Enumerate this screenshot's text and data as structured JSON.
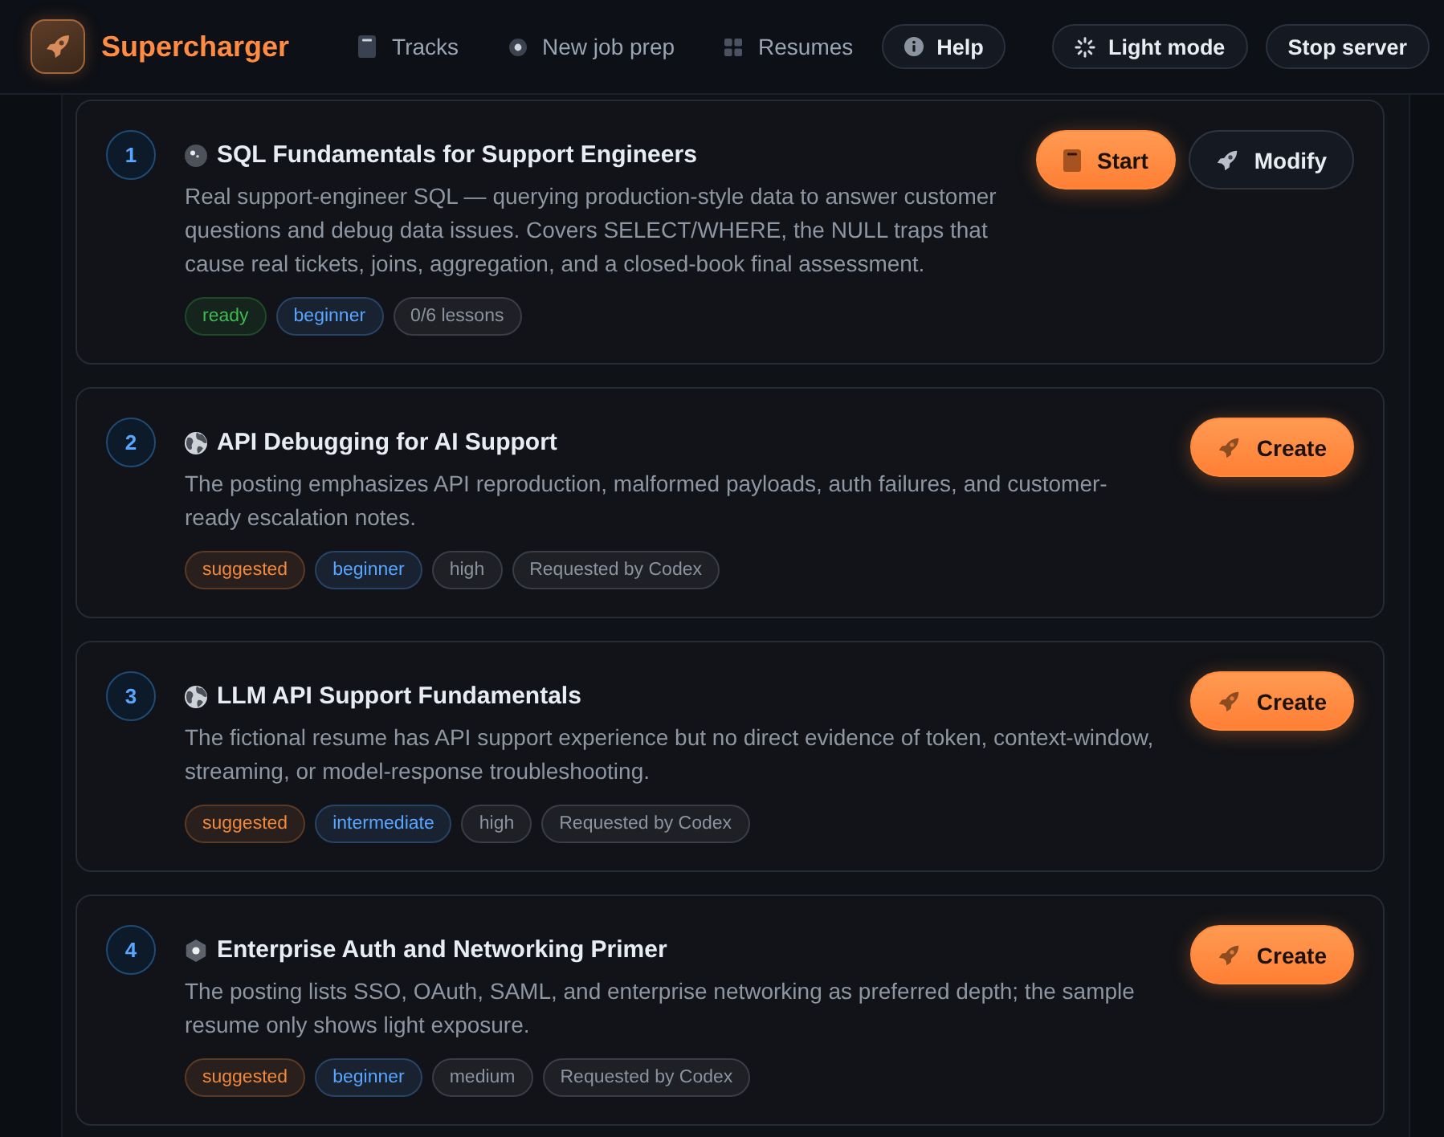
{
  "header": {
    "brand": "Supercharger",
    "nav": [
      {
        "label": "Tracks"
      },
      {
        "label": "New job prep"
      },
      {
        "label": "Resumes"
      }
    ],
    "help": "Help",
    "actions": [
      "Light mode",
      "Stop server"
    ]
  },
  "tracks": [
    {
      "number": "1",
      "title": "SQL Fundamentals for Support Engineers",
      "description": "Real support-engineer SQL — querying production-style data to answer customer questions and debug data issues. Covers SELECT/WHERE, the NULL traps that cause real tickets, joins, aggregation, and a closed-book final assessment.",
      "tags": [
        {
          "label": "ready",
          "color": "#3fb950"
        },
        {
          "label": "beginner",
          "color": "#58a6ff"
        },
        {
          "label": "0/6 lessons",
          "color": "#8b949e"
        }
      ],
      "buttons": [
        {
          "kind": "start",
          "label": "Start"
        },
        {
          "kind": "modify",
          "label": "Modify"
        }
      ]
    },
    {
      "number": "2",
      "title": "API Debugging for AI Support",
      "description": "The posting emphasizes API reproduction, malformed payloads, auth failures, and customer-ready escalation notes.",
      "tags": [
        {
          "label": "suggested",
          "color": "#f0883e"
        },
        {
          "label": "beginner",
          "color": "#58a6ff"
        },
        {
          "label": "high",
          "color": "#8b949e"
        },
        {
          "label": "Requested by Codex",
          "color": "#8b949e"
        }
      ],
      "buttons": [
        {
          "kind": "create",
          "label": "Create"
        }
      ]
    },
    {
      "number": "3",
      "title": "LLM API Support Fundamentals",
      "description": "The fictional resume has API support experience but no direct evidence of token, context-window, streaming, or model-response troubleshooting.",
      "tags": [
        {
          "label": "suggested",
          "color": "#f0883e"
        },
        {
          "label": "intermediate",
          "color": "#58a6ff"
        },
        {
          "label": "high",
          "color": "#8b949e"
        },
        {
          "label": "Requested by Codex",
          "color": "#8b949e"
        }
      ],
      "buttons": [
        {
          "kind": "create",
          "label": "Create"
        }
      ]
    },
    {
      "number": "4",
      "title": "Enterprise Auth and Networking Primer",
      "description": "The posting lists SSO, OAuth, SAML, and enterprise networking as preferred depth; the sample resume only shows light exposure.",
      "tags": [
        {
          "label": "suggested",
          "color": "#f0883e"
        },
        {
          "label": "beginner",
          "color": "#58a6ff"
        },
        {
          "label": "medium",
          "color": "#8b949e"
        },
        {
          "label": "Requested by Codex",
          "color": "#8b949e"
        }
      ],
      "buttons": [
        {
          "kind": "create",
          "label": "Create"
        }
      ]
    }
  ]
}
